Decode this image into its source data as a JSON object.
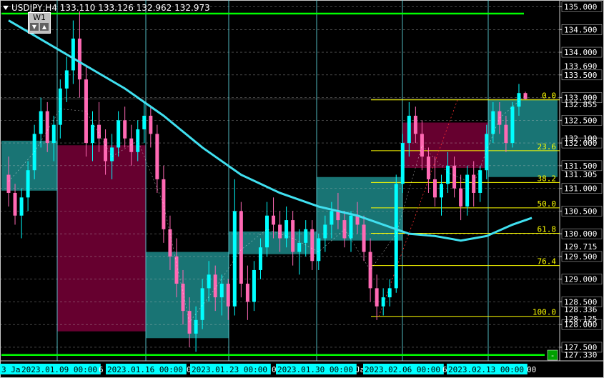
{
  "header": {
    "symbol": "USDJPY,H4",
    "ohlc": "133.110 133.126 132.962 132.973"
  },
  "w1_panel": {
    "label": "W1",
    "down_glyph": "▼",
    "up_glyph": "▲"
  },
  "corner_button": "-",
  "colors": {
    "background": "#000000",
    "bull": "#00ffff",
    "bear": "#ff69b4",
    "bull_zone": "#1a7a7a",
    "bear_zone": "#6b0032",
    "green_level": "#00ff00",
    "fibo": "#ffff00",
    "ma": "#40e0f0",
    "grid": "#c8c8c8",
    "session_line": "#5fd7e0",
    "axis_text": "#ffffff",
    "time_label_bg": "#00ffff"
  },
  "chart_data": {
    "type": "candlestick",
    "title": "USDJPY,H4",
    "ylim": [
      127.2,
      135.15
    ],
    "y_ticks": [
      "135.000",
      "134.500",
      "134.000",
      "133.500",
      "133.000",
      "132.500",
      "132.000",
      "131.500",
      "131.000",
      "130.500",
      "130.000",
      "129.500",
      "129.000",
      "128.500",
      "128.000",
      "127.500"
    ],
    "level_labels": [
      {
        "text": "133.690",
        "value": 133.69
      },
      {
        "text": "132.855",
        "value": 132.855
      },
      {
        "text": "132.100",
        "value": 132.1
      },
      {
        "text": "131.305",
        "value": 131.305
      },
      {
        "text": "129.715",
        "value": 129.715
      },
      {
        "text": "128.336",
        "value": 128.336
      },
      {
        "text": "128.125",
        "value": 128.125
      },
      {
        "text": "127.330",
        "value": 127.33
      }
    ],
    "green_levels": [
      134.85,
      127.33
    ],
    "x_labels": [
      "3 Jan",
      "2023.01.09 00:00",
      "6",
      "2023.01.16 00:00",
      "0",
      "2023.01.23 00:00",
      "0",
      "2023.01.30 00:00",
      "Ja",
      "2023.02.06 00:00",
      "6",
      "2023.02.13 00:00",
      "00"
    ],
    "fibonacci": [
      {
        "label": "0.0",
        "price": 132.95
      },
      {
        "label": "23.6",
        "price": 131.83
      },
      {
        "label": "38.2",
        "price": 131.13
      },
      {
        "label": "50.0",
        "price": 130.57
      },
      {
        "label": "61.8",
        "price": 130.01
      },
      {
        "label": "76.4",
        "price": 129.3
      },
      {
        "label": "100.0",
        "price": 128.18
      }
    ],
    "zones": [
      {
        "kind": "bull",
        "x0": "2023.01.03",
        "x1": "2023.01.06",
        "y0": 132.05,
        "y1": 130.95
      },
      {
        "kind": "bear",
        "x0": "2023.01.09",
        "x1": "2023.01.16",
        "y0": 131.95,
        "y1": 127.85
      },
      {
        "kind": "bull",
        "x0": "2023.01.16",
        "x1": "2023.01.23",
        "y0": 129.6,
        "y1": 127.7
      },
      {
        "kind": "bull",
        "x0": "2023.01.23",
        "x1": "2023.01.30",
        "y0": 130.05,
        "y1": 129.55
      },
      {
        "kind": "bull",
        "x0": "2023.01.30",
        "x1": "2023.02.06",
        "y0": 131.25,
        "y1": 129.85
      },
      {
        "kind": "bear",
        "x0": "2023.02.06",
        "x1": "2023.02.13",
        "y0": 132.45,
        "y1": 131.45
      },
      {
        "kind": "bull",
        "x0": "2023.02.13",
        "x1": "2023.02.16",
        "y0": 132.95,
        "y1": 131.25
      }
    ],
    "candles": [
      {
        "o": 131.3,
        "h": 131.7,
        "l": 130.6,
        "c": 130.9
      },
      {
        "o": 130.9,
        "h": 131.1,
        "l": 130.2,
        "c": 130.4
      },
      {
        "o": 130.4,
        "h": 131.0,
        "l": 129.9,
        "c": 130.8
      },
      {
        "o": 130.8,
        "h": 131.6,
        "l": 130.5,
        "c": 131.4
      },
      {
        "o": 131.4,
        "h": 132.4,
        "l": 131.2,
        "c": 132.2
      },
      {
        "o": 132.2,
        "h": 133.0,
        "l": 131.9,
        "c": 132.7
      },
      {
        "o": 132.7,
        "h": 132.9,
        "l": 131.8,
        "c": 132.0
      },
      {
        "o": 132.0,
        "h": 132.6,
        "l": 131.6,
        "c": 132.4
      },
      {
        "o": 132.4,
        "h": 133.4,
        "l": 132.1,
        "c": 133.2
      },
      {
        "o": 133.2,
        "h": 133.9,
        "l": 132.9,
        "c": 133.6
      },
      {
        "o": 133.6,
        "h": 134.7,
        "l": 133.3,
        "c": 134.3
      },
      {
        "o": 134.3,
        "h": 134.9,
        "l": 133.0,
        "c": 133.4
      },
      {
        "o": 133.4,
        "h": 133.7,
        "l": 131.7,
        "c": 132.0
      },
      {
        "o": 132.0,
        "h": 132.7,
        "l": 131.6,
        "c": 132.4
      },
      {
        "o": 132.4,
        "h": 132.9,
        "l": 131.8,
        "c": 132.1
      },
      {
        "o": 132.1,
        "h": 132.3,
        "l": 131.3,
        "c": 131.6
      },
      {
        "o": 131.6,
        "h": 132.2,
        "l": 131.2,
        "c": 131.9
      },
      {
        "o": 131.9,
        "h": 132.7,
        "l": 131.7,
        "c": 132.5
      },
      {
        "o": 132.5,
        "h": 132.8,
        "l": 131.9,
        "c": 132.1
      },
      {
        "o": 132.1,
        "h": 132.4,
        "l": 131.5,
        "c": 131.8
      },
      {
        "o": 131.8,
        "h": 132.5,
        "l": 131.6,
        "c": 132.3
      },
      {
        "o": 132.3,
        "h": 132.9,
        "l": 132.0,
        "c": 132.6
      },
      {
        "o": 132.6,
        "h": 132.8,
        "l": 131.9,
        "c": 132.2
      },
      {
        "o": 132.2,
        "h": 132.4,
        "l": 130.9,
        "c": 131.2
      },
      {
        "o": 131.2,
        "h": 131.5,
        "l": 129.8,
        "c": 130.1
      },
      {
        "o": 130.1,
        "h": 130.4,
        "l": 129.2,
        "c": 129.5
      },
      {
        "o": 129.5,
        "h": 129.9,
        "l": 128.6,
        "c": 128.9
      },
      {
        "o": 128.9,
        "h": 129.2,
        "l": 128.0,
        "c": 128.3
      },
      {
        "o": 128.3,
        "h": 128.6,
        "l": 127.5,
        "c": 127.8
      },
      {
        "o": 127.8,
        "h": 128.4,
        "l": 127.4,
        "c": 128.1
      },
      {
        "o": 128.1,
        "h": 129.0,
        "l": 127.9,
        "c": 128.8
      },
      {
        "o": 128.8,
        "h": 129.4,
        "l": 128.5,
        "c": 129.1
      },
      {
        "o": 129.1,
        "h": 129.3,
        "l": 128.3,
        "c": 128.6
      },
      {
        "o": 128.6,
        "h": 129.1,
        "l": 128.2,
        "c": 128.9
      },
      {
        "o": 128.9,
        "h": 129.0,
        "l": 128.1,
        "c": 128.4
      },
      {
        "o": 128.4,
        "h": 131.2,
        "l": 128.2,
        "c": 130.5
      },
      {
        "o": 130.5,
        "h": 130.7,
        "l": 128.6,
        "c": 128.9
      },
      {
        "o": 128.9,
        "h": 129.3,
        "l": 128.1,
        "c": 128.5
      },
      {
        "o": 128.5,
        "h": 129.4,
        "l": 128.3,
        "c": 129.2
      },
      {
        "o": 129.2,
        "h": 129.9,
        "l": 129.0,
        "c": 129.7
      },
      {
        "o": 129.7,
        "h": 130.7,
        "l": 129.5,
        "c": 130.4
      },
      {
        "o": 130.4,
        "h": 130.8,
        "l": 129.9,
        "c": 130.2
      },
      {
        "o": 130.2,
        "h": 130.5,
        "l": 129.6,
        "c": 129.9
      },
      {
        "o": 129.9,
        "h": 130.6,
        "l": 129.7,
        "c": 130.3
      },
      {
        "o": 130.3,
        "h": 130.5,
        "l": 129.3,
        "c": 129.6
      },
      {
        "o": 129.6,
        "h": 130.1,
        "l": 129.1,
        "c": 129.8
      },
      {
        "o": 129.8,
        "h": 130.3,
        "l": 129.5,
        "c": 130.1
      },
      {
        "o": 130.1,
        "h": 130.3,
        "l": 129.2,
        "c": 129.4
      },
      {
        "o": 129.4,
        "h": 130.0,
        "l": 129.2,
        "c": 129.9
      },
      {
        "o": 129.9,
        "h": 130.4,
        "l": 129.6,
        "c": 130.2
      },
      {
        "o": 130.2,
        "h": 130.7,
        "l": 129.9,
        "c": 130.5
      },
      {
        "o": 130.5,
        "h": 130.9,
        "l": 130.1,
        "c": 130.3
      },
      {
        "o": 130.3,
        "h": 130.5,
        "l": 129.7,
        "c": 129.9
      },
      {
        "o": 129.9,
        "h": 130.5,
        "l": 129.6,
        "c": 130.4
      },
      {
        "o": 130.4,
        "h": 130.7,
        "l": 130.0,
        "c": 130.2
      },
      {
        "o": 130.2,
        "h": 130.4,
        "l": 129.4,
        "c": 129.6
      },
      {
        "o": 129.6,
        "h": 129.9,
        "l": 128.5,
        "c": 128.8
      },
      {
        "o": 128.8,
        "h": 129.1,
        "l": 128.1,
        "c": 128.4
      },
      {
        "o": 128.4,
        "h": 128.8,
        "l": 128.2,
        "c": 128.6
      },
      {
        "o": 128.6,
        "h": 129.0,
        "l": 128.4,
        "c": 128.8
      },
      {
        "o": 128.8,
        "h": 131.3,
        "l": 128.7,
        "c": 131.1
      },
      {
        "o": 131.1,
        "h": 132.2,
        "l": 130.9,
        "c": 132.0
      },
      {
        "o": 132.0,
        "h": 132.9,
        "l": 131.7,
        "c": 132.6
      },
      {
        "o": 132.6,
        "h": 132.8,
        "l": 132.0,
        "c": 132.2
      },
      {
        "o": 132.2,
        "h": 132.5,
        "l": 131.4,
        "c": 131.7
      },
      {
        "o": 131.7,
        "h": 131.9,
        "l": 130.9,
        "c": 131.2
      },
      {
        "o": 131.2,
        "h": 131.7,
        "l": 130.6,
        "c": 130.8
      },
      {
        "o": 130.8,
        "h": 131.3,
        "l": 130.4,
        "c": 131.1
      },
      {
        "o": 131.1,
        "h": 131.8,
        "l": 130.9,
        "c": 131.5
      },
      {
        "o": 131.5,
        "h": 131.7,
        "l": 130.8,
        "c": 131.0
      },
      {
        "o": 131.0,
        "h": 131.3,
        "l": 130.3,
        "c": 130.6
      },
      {
        "o": 130.6,
        "h": 131.5,
        "l": 130.4,
        "c": 131.3
      },
      {
        "o": 131.3,
        "h": 131.6,
        "l": 130.6,
        "c": 130.9
      },
      {
        "o": 130.9,
        "h": 131.5,
        "l": 130.7,
        "c": 131.4
      },
      {
        "o": 131.4,
        "h": 132.4,
        "l": 131.2,
        "c": 132.2
      },
      {
        "o": 132.2,
        "h": 132.9,
        "l": 132.0,
        "c": 132.7
      },
      {
        "o": 132.7,
        "h": 132.9,
        "l": 132.2,
        "c": 132.4
      },
      {
        "o": 132.4,
        "h": 132.6,
        "l": 131.8,
        "c": 132.0
      },
      {
        "o": 132.0,
        "h": 132.9,
        "l": 131.9,
        "c": 132.8
      },
      {
        "o": 132.8,
        "h": 133.3,
        "l": 132.6,
        "c": 133.1
      },
      {
        "o": 133.1,
        "h": 133.13,
        "l": 132.96,
        "c": 132.97
      }
    ],
    "moving_average": [
      {
        "i": 0,
        "v": 134.7
      },
      {
        "i": 6,
        "v": 134.2
      },
      {
        "i": 12,
        "v": 133.7
      },
      {
        "i": 18,
        "v": 133.2
      },
      {
        "i": 24,
        "v": 132.6
      },
      {
        "i": 30,
        "v": 131.9
      },
      {
        "i": 36,
        "v": 131.3
      },
      {
        "i": 42,
        "v": 130.9
      },
      {
        "i": 48,
        "v": 130.6
      },
      {
        "i": 54,
        "v": 130.4
      },
      {
        "i": 58,
        "v": 130.2
      },
      {
        "i": 62,
        "v": 130.0
      },
      {
        "i": 66,
        "v": 129.95
      },
      {
        "i": 70,
        "v": 129.85
      },
      {
        "i": 74,
        "v": 129.95
      },
      {
        "i": 78,
        "v": 130.2
      },
      {
        "i": 81,
        "v": 130.35
      }
    ]
  }
}
